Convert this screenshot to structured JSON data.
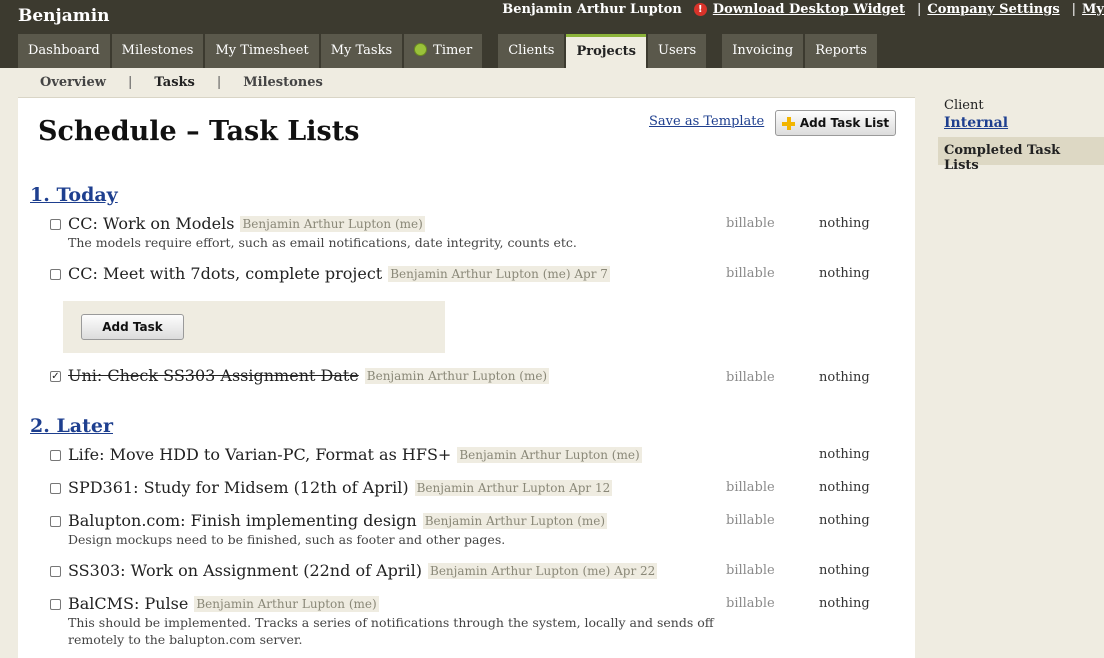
{
  "header": {
    "brand": "Benjamin",
    "user_name": "Benjamin Arthur Lupton",
    "download_widget": "Download Desktop Widget",
    "company_settings": "Company Settings",
    "cut_link": "My",
    "separator": "|"
  },
  "tabs": [
    {
      "label": "Dashboard"
    },
    {
      "label": "Milestones"
    },
    {
      "label": "My Timesheet"
    },
    {
      "label": "My Tasks"
    },
    {
      "label": "Timer"
    },
    {
      "label": "Clients"
    },
    {
      "label": "Projects"
    },
    {
      "label": "Users"
    },
    {
      "label": "Invoicing"
    },
    {
      "label": "Reports"
    }
  ],
  "subnav": {
    "overview": "Overview",
    "tasks": "Tasks",
    "milestones": "Milestones",
    "separator": "|"
  },
  "page": {
    "title": "Schedule – Task Lists",
    "save_template": "Save as Template",
    "add_task_list": "Add Task List",
    "add_task": "Add Task"
  },
  "lists": [
    {
      "title": "1. Today",
      "tasks": [
        {
          "name": "CC: Work on Models",
          "who": "Benjamin Arthur Lupton (me)",
          "desc": "The models require effort, such as email notifications, date integrity, counts etc.",
          "billable": "billable",
          "amount": "nothing",
          "done": false
        },
        {
          "name": "CC: Meet with 7dots, complete project",
          "who": "Benjamin Arthur Lupton (me) Apr 7",
          "desc": "",
          "billable": "billable",
          "amount": "nothing",
          "done": false
        },
        {
          "name": "Uni: Check SS303 Assignment Date",
          "who": "Benjamin Arthur Lupton (me)",
          "desc": "",
          "billable": "billable",
          "amount": "nothing",
          "done": true
        }
      ]
    },
    {
      "title": "2. Later",
      "tasks": [
        {
          "name": "Life: Move HDD to Varian-PC, Format as HFS+",
          "who": "Benjamin Arthur Lupton (me)",
          "desc": "",
          "billable": "",
          "amount": "nothing",
          "done": false
        },
        {
          "name": "SPD361: Study for Midsem (12th of April)",
          "who": "Benjamin Arthur Lupton Apr 12",
          "desc": "",
          "billable": "billable",
          "amount": "nothing",
          "done": false
        },
        {
          "name": "Balupton.com: Finish implementing design",
          "who": "Benjamin Arthur Lupton (me)",
          "desc": "Design mockups need to be finished, such as footer and other pages.",
          "billable": "billable",
          "amount": "nothing",
          "done": false
        },
        {
          "name": "SS303: Work on Assignment (22nd of April)",
          "who": "Benjamin Arthur Lupton (me) Apr 22",
          "desc": "",
          "billable": "billable",
          "amount": "nothing",
          "done": false
        },
        {
          "name": "BalCMS: Pulse",
          "who": "Benjamin Arthur Lupton (me)",
          "desc": "This should be implemented. Tracks a series of notifications through the system, locally and sends off remotely to the balupton.com server.",
          "billable": "billable",
          "amount": "nothing",
          "done": false
        }
      ]
    }
  ],
  "sidebar": {
    "client_label": "Client",
    "client_name": "Internal",
    "completed": "Completed Task Lists"
  },
  "colors": {
    "header_bg": "#3c3a2f",
    "tab_bg": "#5a584b",
    "link_blue": "#1e3f8f",
    "active_tab_accent": "#8cb33a",
    "page_bg": "#efece1"
  }
}
